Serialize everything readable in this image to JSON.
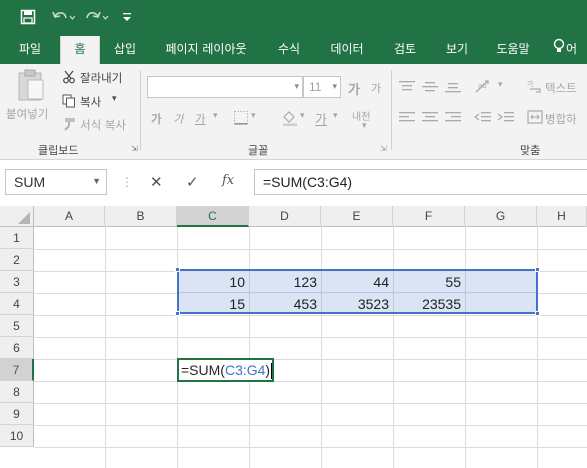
{
  "quick_access": {
    "save_icon": "save-icon",
    "undo_icon": "undo-icon",
    "redo_icon": "redo-icon",
    "customize_icon": "customize-icon"
  },
  "tabs": [
    "파일",
    "홈",
    "삽입",
    "페이지 레이아웃",
    "수식",
    "데이터",
    "검토",
    "보기",
    "도움말",
    "어"
  ],
  "active_tab": "홈",
  "tell_me_icon": "lightbulb-icon",
  "ribbon": {
    "clipboard": {
      "paste": "붙여넣기",
      "cut": "잘라내기",
      "copy": "복사",
      "format_painter": "서식 복사",
      "label": "클립보드"
    },
    "font": {
      "font_size": "11",
      "label": "글꼴",
      "increase_font": "가",
      "decrease_font": "가",
      "bold": "가",
      "italic": "가",
      "underline": "가",
      "phonetic": "내천"
    },
    "alignment": {
      "wrap_text": "텍스트",
      "merge": "병합하",
      "label": "맞춤"
    }
  },
  "formula_bar": {
    "name_box": "SUM",
    "cancel": "✕",
    "enter": "✓",
    "fx": "fx",
    "formula": "=SUM(C3:G4)"
  },
  "columns": [
    "A",
    "B",
    "C",
    "D",
    "E",
    "F",
    "G",
    "H"
  ],
  "selected_column": "C",
  "rows": [
    "1",
    "2",
    "3",
    "4",
    "5",
    "6",
    "7",
    "8",
    "9",
    "10"
  ],
  "selected_row": "7",
  "cells": {
    "C3": "10",
    "D3": "123",
    "E3": "44",
    "F3": "55",
    "C4": "15",
    "D4": "453",
    "E4": "3523",
    "F4": "23535"
  },
  "edit_cell": {
    "prefix": "=SUM(",
    "ref": "C3:G4",
    "suffix": ")"
  },
  "colors": {
    "excel_green": "#217346",
    "range_blue": "#4472c4",
    "range_fill": "#d6e1f3"
  }
}
